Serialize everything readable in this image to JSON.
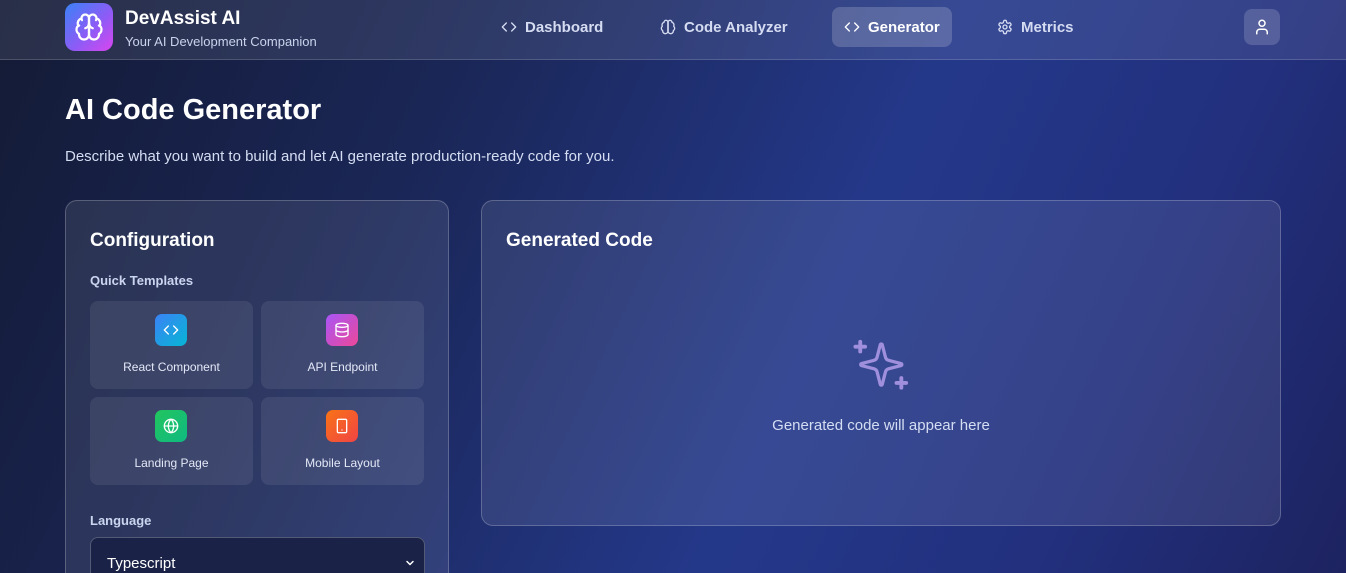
{
  "app": {
    "name": "DevAssist AI",
    "tagline": "Your AI Development Companion",
    "logo_icon": "brain-icon",
    "accent_gradient": [
      "#3b82f6",
      "#8b5cf6",
      "#d946ef"
    ]
  },
  "nav": {
    "items": [
      {
        "label": "Dashboard",
        "icon": "code-icon",
        "active": false
      },
      {
        "label": "Code Analyzer",
        "icon": "brain-icon",
        "active": false
      },
      {
        "label": "Generator",
        "icon": "code-icon",
        "active": true
      },
      {
        "label": "Metrics",
        "icon": "gear-icon",
        "active": false
      }
    ],
    "user_icon": "user-icon"
  },
  "page": {
    "title": "AI Code Generator",
    "description": "Describe what you want to build and let AI generate production-ready code for you."
  },
  "config": {
    "title": "Configuration",
    "templates_label": "Quick Templates",
    "templates": [
      {
        "label": "React Component",
        "icon": "code-icon",
        "colors": [
          "#3b82f6",
          "#06b6d4"
        ]
      },
      {
        "label": "API Endpoint",
        "icon": "database-icon",
        "colors": [
          "#a855f7",
          "#ec4899"
        ]
      },
      {
        "label": "Landing Page",
        "icon": "globe-icon",
        "colors": [
          "#22c55e",
          "#10b981"
        ]
      },
      {
        "label": "Mobile Layout",
        "icon": "smartphone-icon",
        "colors": [
          "#f97316",
          "#ef4444"
        ]
      }
    ],
    "language_label": "Language",
    "language_value": "Typescript"
  },
  "output": {
    "title": "Generated Code",
    "placeholder_icon": "sparkles-icon",
    "placeholder_text": "Generated code will appear here",
    "placeholder_color": "#9f8fdc"
  }
}
